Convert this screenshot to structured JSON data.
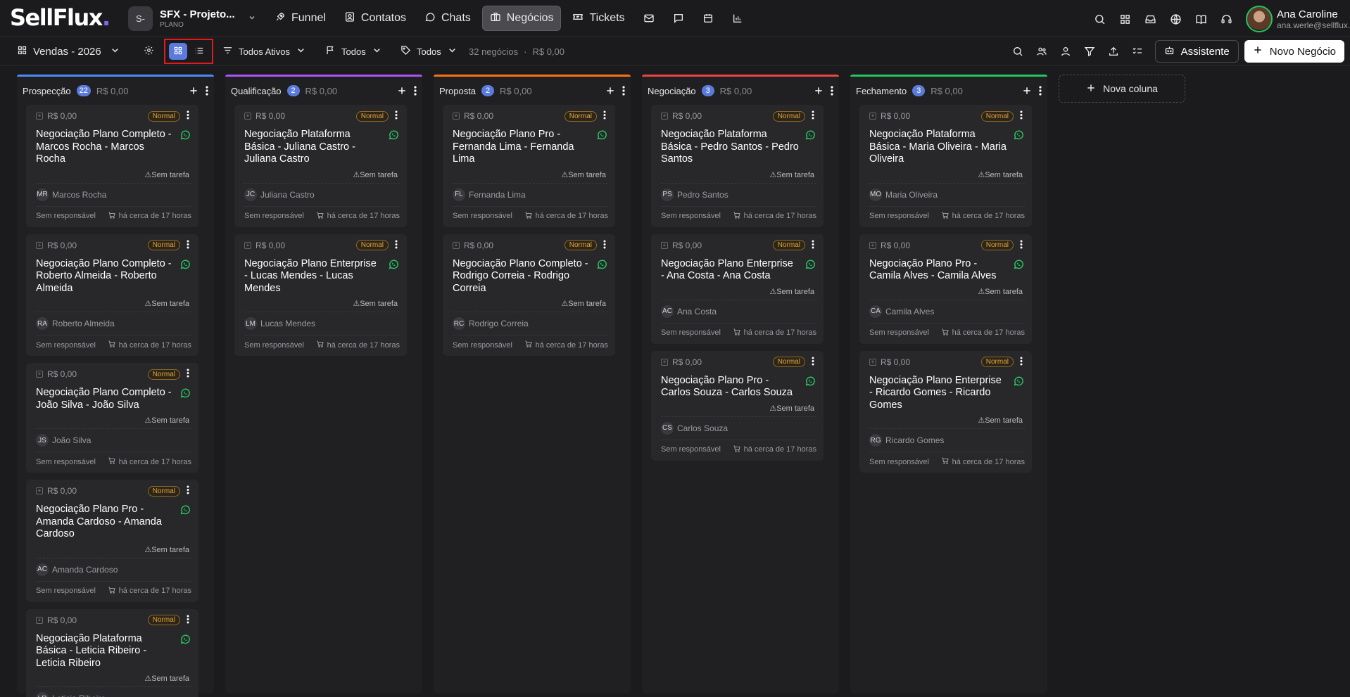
{
  "app": {
    "logo": "SellFlux",
    "logo_dot": "."
  },
  "workspace": {
    "initials": "S-",
    "name": "SFX - Projeto...",
    "plan": "PLANO"
  },
  "nav": [
    {
      "label": "Funnel",
      "icon": "rocket-icon"
    },
    {
      "label": "Contatos",
      "icon": "contacts-icon"
    },
    {
      "label": "Chats",
      "icon": "chat-icon"
    },
    {
      "label": "Negócios",
      "icon": "briefcase-icon",
      "active": true
    },
    {
      "label": "Tickets",
      "icon": "ticket-icon"
    }
  ],
  "user": {
    "name": "Ana Caroline",
    "email": "ana.werle@sellflux..."
  },
  "toolbar": {
    "pipeline": "Vendas - 2026",
    "status_filter": "Todos Ativos",
    "filter_flag": "Todos",
    "filter_tag": "Todos",
    "summary_count": "32 negócios",
    "summary_sep": "·",
    "summary_value": "R$ 0,00",
    "assistant_label": "Assistente",
    "new_deal_label": "Novo Negócio"
  },
  "labels": {
    "no_task": "Sem tarefa",
    "no_owner": "Sem responsável",
    "time_ago": "há cerca de 17 horas",
    "priority": "Normal",
    "new_column": "Nova coluna"
  },
  "colors": {
    "prospeccao": "#4b8bf5",
    "qualificacao": "#a855f7",
    "proposta": "#f97316",
    "negociacao": "#ef4444",
    "fechamento": "#22c55e",
    "accent": "#5b7bdc"
  },
  "columns": [
    {
      "title": "Prospecção",
      "count": "22",
      "value": "R$ 0,00",
      "cards": [
        {
          "value": "R$ 0,00",
          "title": "Negociação Plano Completo - Marcos Rocha - Marcos Rocha",
          "initials": "MR",
          "contact": "Marcos Rocha"
        },
        {
          "value": "R$ 0,00",
          "title": "Negociação Plano Completo - Roberto Almeida - Roberto Almeida",
          "initials": "RA",
          "contact": "Roberto Almeida"
        },
        {
          "value": "R$ 0,00",
          "title": "Negociação Plano Completo - João Silva - João Silva",
          "initials": "JS",
          "contact": "João Silva"
        },
        {
          "value": "R$ 0,00",
          "title": "Negociação Plano Pro - Amanda Cardoso - Amanda Cardoso",
          "initials": "AC",
          "contact": "Amanda Cardoso"
        },
        {
          "value": "R$ 0,00",
          "title": "Negociação Plataforma Básica - Leticia Ribeiro - Leticia Ribeiro",
          "initials": "LR",
          "contact": "Leticia Ribeiro"
        }
      ]
    },
    {
      "title": "Qualificação",
      "count": "2",
      "value": "R$ 0,00",
      "cards": [
        {
          "value": "R$ 0,00",
          "title": "Negociação Plataforma Básica - Juliana Castro - Juliana Castro",
          "initials": "JC",
          "contact": "Juliana Castro"
        },
        {
          "value": "R$ 0,00",
          "title": "Negociação Plano Enterprise - Lucas Mendes - Lucas Mendes",
          "initials": "LM",
          "contact": "Lucas Mendes"
        }
      ]
    },
    {
      "title": "Proposta",
      "count": "2",
      "value": "R$ 0,00",
      "cards": [
        {
          "value": "R$ 0,00",
          "title": "Negociação Plano Pro - Fernanda Lima - Fernanda Lima",
          "initials": "FL",
          "contact": "Fernanda Lima"
        },
        {
          "value": "R$ 0,00",
          "title": "Negociação Plano Completo - Rodrigo Correia - Rodrigo Correia",
          "initials": "RC",
          "contact": "Rodrigo Correia"
        }
      ]
    },
    {
      "title": "Negociação",
      "count": "3",
      "value": "R$ 0,00",
      "cards": [
        {
          "value": "R$ 0,00",
          "title": "Negociação Plataforma Básica - Pedro Santos - Pedro Santos",
          "initials": "PS",
          "contact": "Pedro Santos"
        },
        {
          "value": "R$ 0,00",
          "title": "Negociação Plano Enterprise - Ana Costa - Ana Costa",
          "initials": "AC",
          "contact": "Ana Costa"
        },
        {
          "value": "R$ 0,00",
          "title": "Negociação Plano Pro - Carlos Souza - Carlos Souza",
          "initials": "CS",
          "contact": "Carlos Souza"
        }
      ]
    },
    {
      "title": "Fechamento",
      "count": "3",
      "value": "R$ 0,00",
      "cards": [
        {
          "value": "R$ 0,00",
          "title": "Negociação Plataforma Básica - Maria Oliveira - Maria Oliveira",
          "initials": "MO",
          "contact": "Maria Oliveira"
        },
        {
          "value": "R$ 0,00",
          "title": "Negociação Plano Pro - Camila Alves - Camila Alves",
          "initials": "CA",
          "contact": "Camila Alves"
        },
        {
          "value": "R$ 0,00",
          "title": "Negociação Plano Enterprise - Ricardo Gomes - Ricardo Gomes",
          "initials": "RG",
          "contact": "Ricardo Gomes"
        }
      ]
    }
  ]
}
